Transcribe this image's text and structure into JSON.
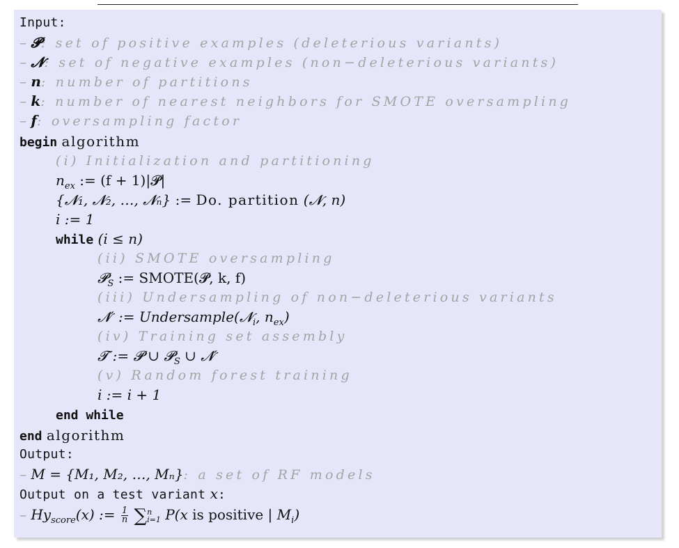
{
  "input_header": "Input:",
  "inputs": [
    {
      "sym": "𝓟",
      "desc": "set of positive examples (deleterious variants)"
    },
    {
      "sym": "𝓝",
      "desc": "set of negative examples (non−deleterious variants)"
    },
    {
      "sym": "n",
      "desc": "number of partitions"
    },
    {
      "sym": "k",
      "desc": "number of nearest neighbors for SMOTE oversampling"
    },
    {
      "sym": "f",
      "desc": "oversampling factor"
    }
  ],
  "begin_keyword": "begin",
  "algorithm_word": "algorithm",
  "comment_init": "(i) Initialization and partitioning",
  "step_nex": "n",
  "step_nex_sub": "ex",
  "step_nex_rhs": " := (f + 1)|𝓟|",
  "step_partition_lhs": "{𝓝₁, 𝓝₂, …, 𝓝ₙ}",
  "step_partition_assign": " := ",
  "step_partition_fn": "Do. partition",
  "step_partition_args": " (𝓝, n)",
  "step_i_init": "i := 1",
  "while_keyword": "while",
  "while_cond": "(i ≤ n)",
  "comment_smote": "(ii) SMOTE oversampling",
  "step_smote": "𝓟",
  "step_smote_sub": "S",
  "step_smote_rhs": " := SMOTE(𝓟, k, f)",
  "comment_under": "(iii) Undersampling of non−deleterious variants",
  "step_under": "𝓝′ := Undersample(𝓝",
  "step_under_sub": "i",
  "step_under_mid": ", n",
  "step_under_sub2": "ex",
  "step_under_end": ")",
  "comment_train": "(iv) Training set assembly",
  "step_train": "𝓣 := 𝓟 ∪ 𝓟",
  "step_train_sub": "S",
  "step_train_end": " ∪ 𝓝′",
  "comment_rf": "(v) Random forest training",
  "step_incr": "i := i + 1",
  "end_while_keyword": "end while",
  "end_keyword": "end",
  "end_algorithm_word": "algorithm",
  "output_header": "Output:",
  "output_set": "M = {M₁, M₂, …, Mₙ}",
  "output_desc": ": a set of RF models",
  "output_test_header": "Output on a test variant",
  "output_test_var": "x",
  "score_lhs": "Hy",
  "score_sub": "score",
  "score_arg": "(x) := ",
  "score_frac_num": "1",
  "score_frac_den": "n",
  "score_sum": "∑",
  "score_sum_upper": "n",
  "score_sum_lower": "i=1",
  "score_rhs_pre": " P(x ",
  "score_rhs_text": "is positive",
  "score_rhs_mid": " | M",
  "score_rhs_sub": "i",
  "score_rhs_end": ")"
}
